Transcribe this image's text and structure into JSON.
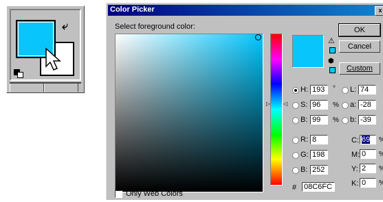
{
  "palette": {
    "foreground_color": "#08c6fc",
    "background_color": "#ffffff",
    "icons": [
      "swap-colors-icon",
      "default-colors-icon",
      "arrow-cursor-icon"
    ]
  },
  "dialog": {
    "title": "Color Picker",
    "close_glyph": "x",
    "prompt": "Select foreground color:",
    "buttons": {
      "ok": "OK",
      "cancel": "Cancel",
      "custom": "Custom"
    },
    "current_color": "#08c6fc",
    "hsb": {
      "h_label": "H:",
      "h_value": "193",
      "h_unit": "°",
      "s_label": "S:",
      "s_value": "96",
      "s_unit": "%",
      "b_label": "B:",
      "b_value": "99",
      "b_unit": "%"
    },
    "rgb": {
      "r_label": "R:",
      "r_value": "8",
      "g_label": "G:",
      "g_value": "198",
      "b_label": "B:",
      "b_value": "252"
    },
    "lab": {
      "l_label": "L:",
      "l_value": "74",
      "a_label": "a:",
      "a_value": "-28",
      "b_label": "b:",
      "b_value": "-39"
    },
    "cmyk": {
      "c_label": "C:",
      "c_value": "69",
      "c_unit": "%",
      "m_label": "M:",
      "m_value": "0",
      "m_unit": "%",
      "y_label": "Y:",
      "y_value": "2",
      "y_unit": "%",
      "k_label": "K:",
      "k_value": "0",
      "k_unit": "%"
    },
    "hex_label": "#",
    "hex_value": "08C6FC",
    "only_web_colors_label": "Only Web Colors",
    "selected_mode": "H"
  }
}
